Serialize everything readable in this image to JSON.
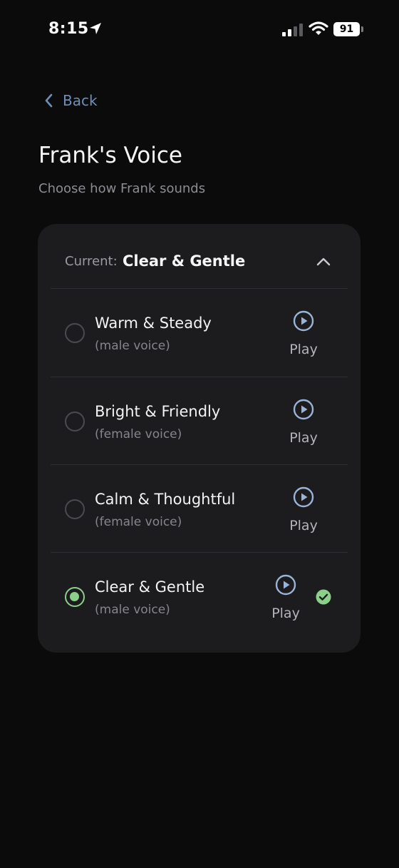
{
  "status_bar": {
    "time": "8:15",
    "battery": "91",
    "icons": [
      "location-arrow-icon",
      "cellular-signal-icon",
      "wifi-icon",
      "battery-icon"
    ]
  },
  "nav": {
    "back_label": "Back"
  },
  "header": {
    "title": "Frank's Voice",
    "subtitle": "Choose how Frank sounds"
  },
  "dropdown": {
    "current_label": "Current:",
    "current_value": "Clear & Gentle"
  },
  "options": [
    {
      "name": "Warm & Steady",
      "sub": "(male voice)",
      "play_label": "Play",
      "selected": false
    },
    {
      "name": "Bright & Friendly",
      "sub": "(female voice)",
      "play_label": "Play",
      "selected": false
    },
    {
      "name": "Calm & Thoughtful",
      "sub": "(female voice)",
      "play_label": "Play",
      "selected": false
    },
    {
      "name": "Clear & Gentle",
      "sub": "(male voice)",
      "play_label": "Play",
      "selected": true
    }
  ],
  "colors": {
    "background": "#0b0b0c",
    "card": "#1c1c1f",
    "accent_blue": "#6e8fb8",
    "play_blue": "#9ab4d8",
    "selected_green": "#8ccf8a"
  }
}
